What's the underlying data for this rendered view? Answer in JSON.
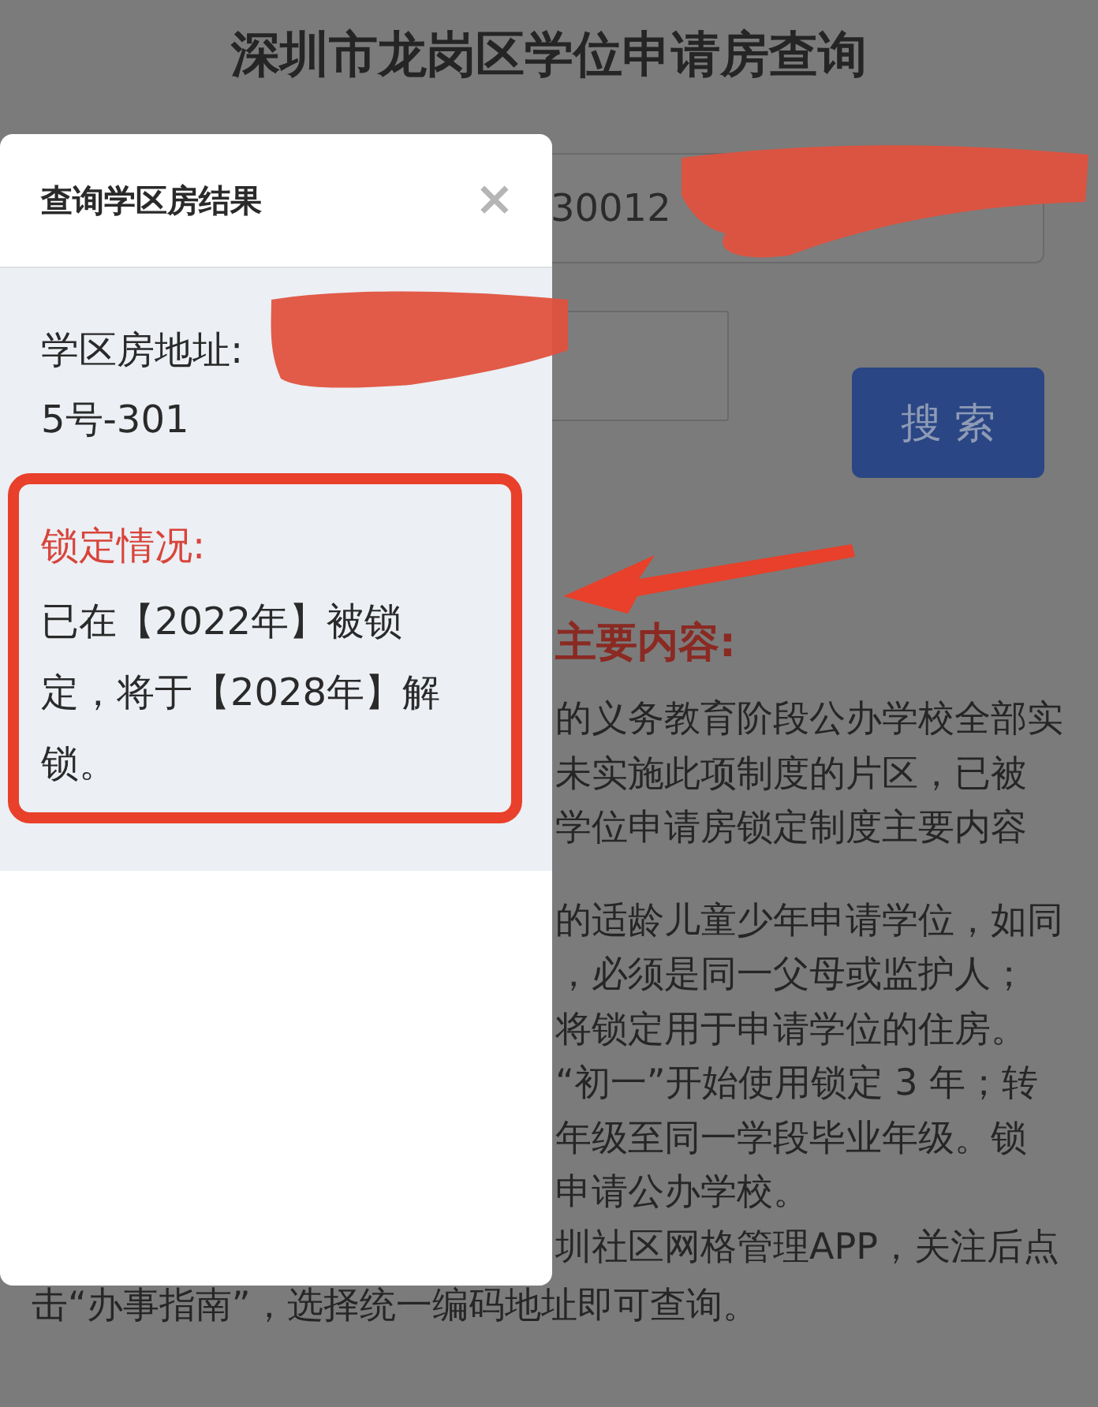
{
  "page": {
    "title": "深圳市龙岗区学位申请房查询",
    "search_form": {
      "number_field": {
        "value": "30012"
      },
      "search_button": "搜 索"
    },
    "section_heading": "主要内容:",
    "paragraph_1": [
      "的义务教育阶段公办学校全部实",
      "未实施此项制度的片区，已被",
      "学位申请房锁定制度主要内容"
    ],
    "paragraph_2": [
      "的适龄儿童少年申请学位，如同",
      "，必须是同一父母或监护人；",
      "将锁定用于申请学位的住房。",
      "“初一”开始使用锁定 3 年；转",
      "年级至同一学段毕业年级。锁",
      "申请公办学校。",
      "圳社区网格管理APP，关注后点"
    ],
    "footer_line": "击“办事指南”，选择统一编码地址即可查询。"
  },
  "dialog": {
    "title": "查询学区房结果",
    "close": "×",
    "address_label": "学区房地址:",
    "address_value": "5号-301",
    "lock_heading": "锁定情况:",
    "lock_text": "已在【2022年】被锁定，将于【2028年】解锁。"
  }
}
